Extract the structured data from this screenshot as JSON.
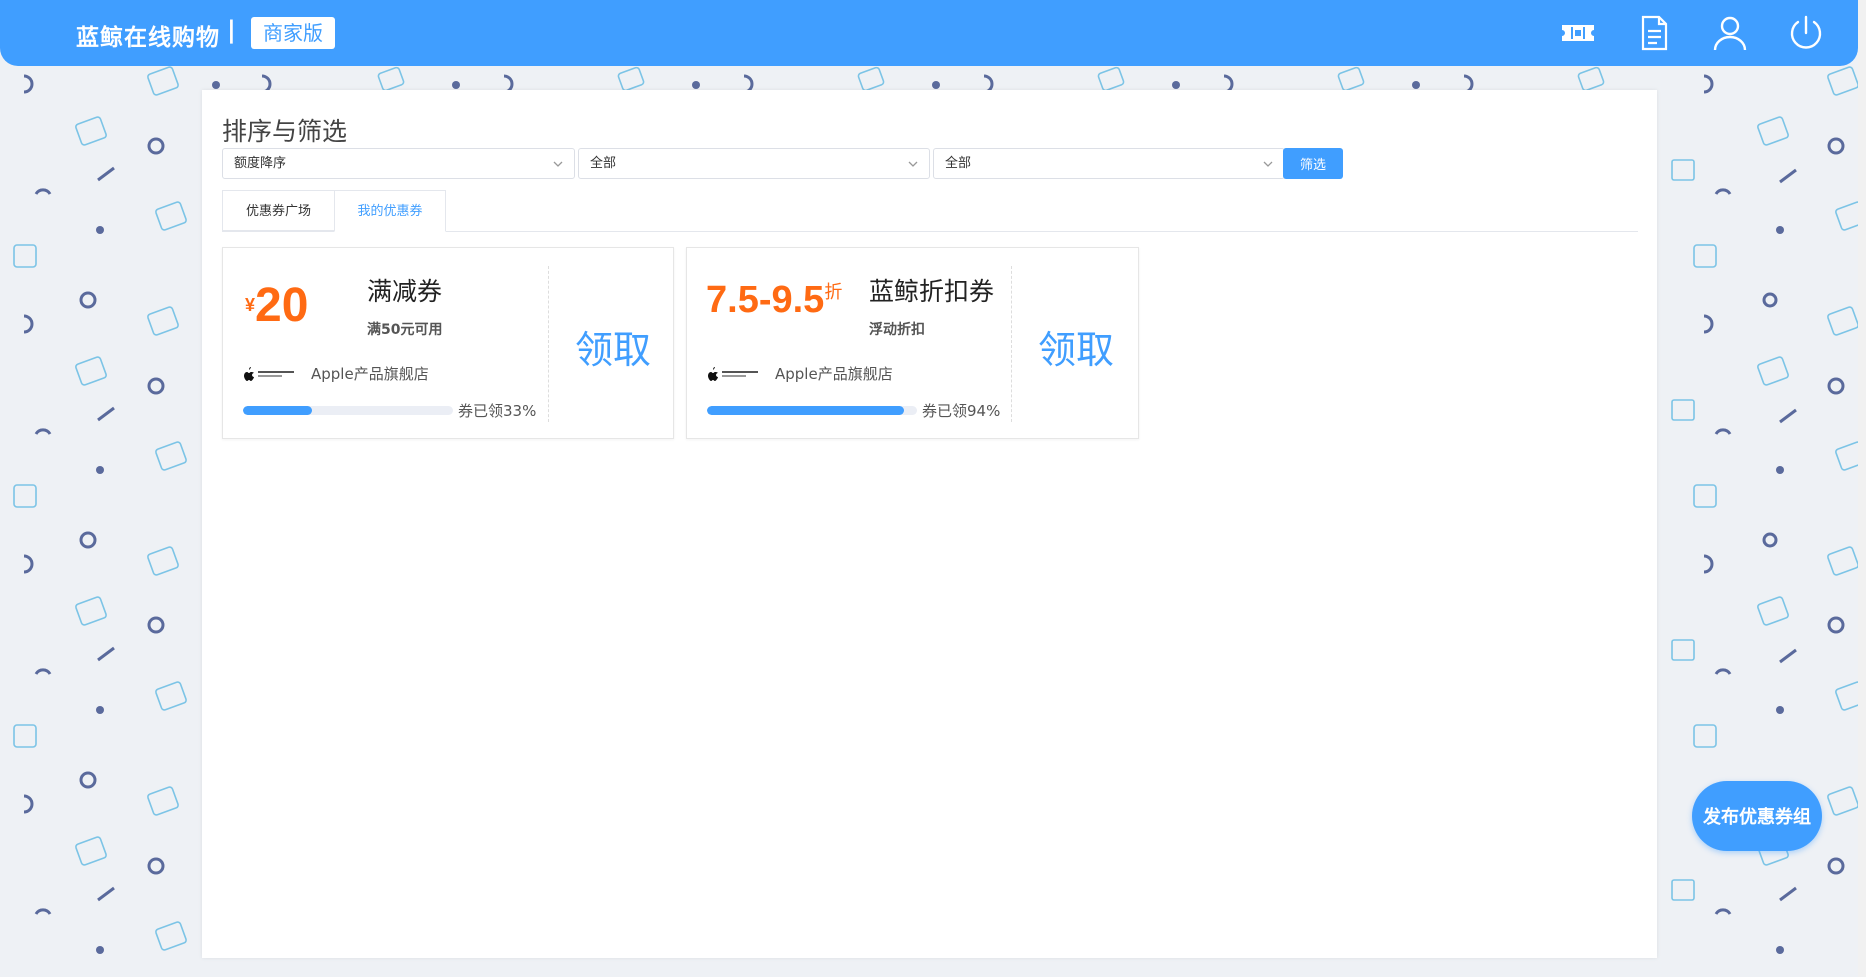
{
  "header": {
    "brand": "蓝鲸在线购物",
    "separator": "|",
    "edition": "商家版",
    "icons": [
      "ticket-icon",
      "document-icon",
      "user-icon",
      "power-icon"
    ]
  },
  "filters": {
    "title": "排序与筛选",
    "sort_value": "额度降序",
    "filter2_value": "全部",
    "filter3_value": "全部",
    "button_label": "筛选"
  },
  "tabs": [
    {
      "label": "优惠券广场",
      "active": false
    },
    {
      "label": "我的优惠券",
      "active": true
    }
  ],
  "coupons": [
    {
      "currency": "¥",
      "amount": "20",
      "title": "满减券",
      "subtitle": "满50元可用",
      "store": "Apple产品旗舰店",
      "progress": 33,
      "progress_label": "券已领33%",
      "claim_label": "领取"
    },
    {
      "amount": "7.5-9.5",
      "unit": "折",
      "title": "蓝鲸折扣券",
      "subtitle": "浮动折扣",
      "store": "Apple产品旗舰店",
      "progress": 94,
      "progress_label": "券已领94%",
      "claim_label": "领取"
    }
  ],
  "publish_button": "发布优惠券组",
  "colors": {
    "primary": "#409eff",
    "amount": "#ff6a13"
  }
}
